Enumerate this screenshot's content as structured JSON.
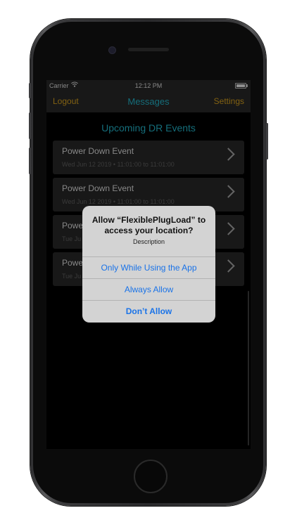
{
  "status_bar": {
    "carrier": "Carrier",
    "time": "12:12 PM"
  },
  "nav": {
    "left": "Logout",
    "title": "Messages",
    "right": "Settings"
  },
  "section_title": "Upcoming DR Events",
  "events": [
    {
      "title": "Power Down Event",
      "subtitle": "Wed Jun 12 2019 • 11:01:00 to 11:01:00"
    },
    {
      "title": "Power Down Event",
      "subtitle": "Wed Jun 12 2019 • 11:01:00 to 11:01:00"
    },
    {
      "title": "Powe",
      "subtitle": "Tue Ju"
    },
    {
      "title": "Powe",
      "subtitle": "Tue Ju"
    }
  ],
  "alert": {
    "title": "Allow “FlexiblePlugLoad” to access your location?",
    "message": "Description",
    "buttons": [
      "Only While Using the App",
      "Always Allow",
      "Don’t Allow"
    ]
  },
  "colors": {
    "accent_teal": "#21a9bd",
    "accent_gold": "#c8961c",
    "alert_button_blue": "#1a73e8"
  }
}
